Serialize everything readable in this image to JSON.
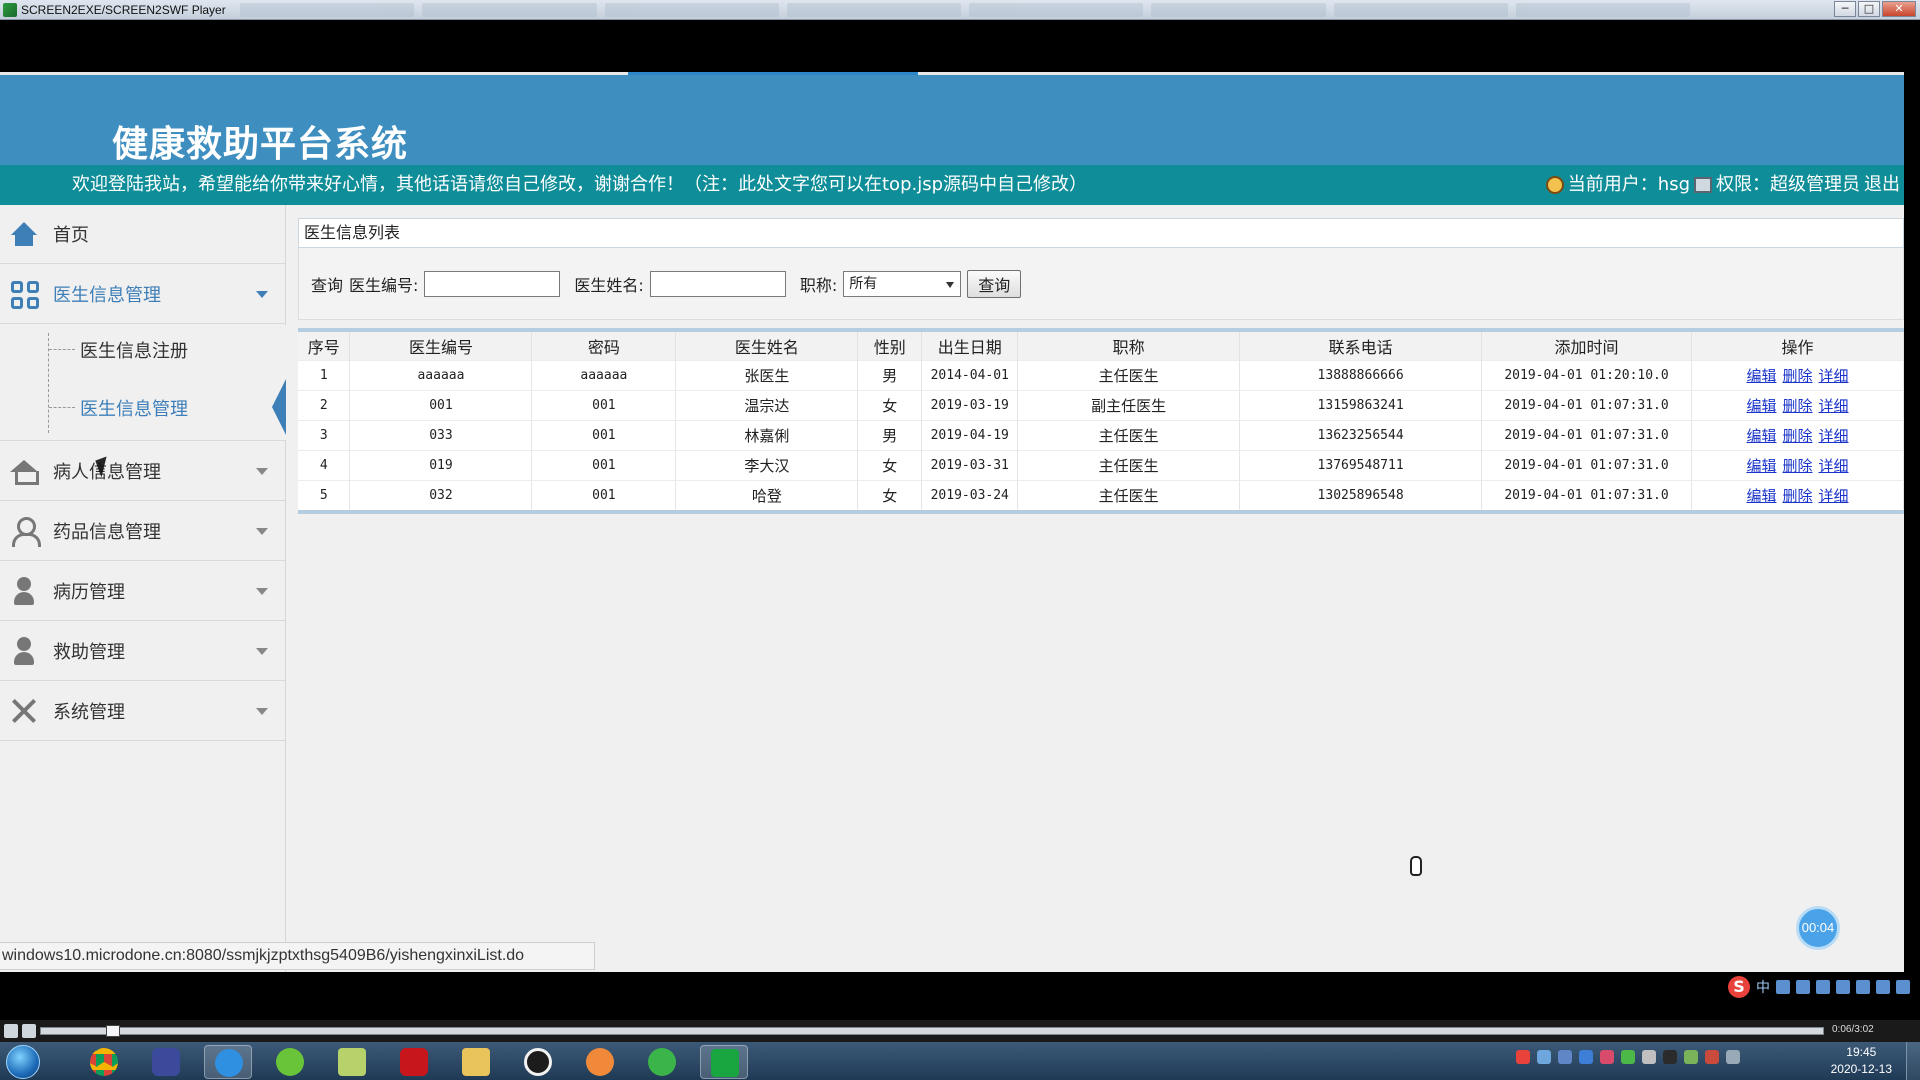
{
  "window": {
    "title": "SCREEN2EXE/SCREEN2SWF Player",
    "minimize": "─",
    "maximize": "□",
    "close": "✕"
  },
  "header": {
    "site_title": "健康救助平台系统",
    "welcome": "欢迎登陆我站，希望能给你带来好心情，其他话语请您自己修改，谢谢合作！（注：此处文字您可以在top.jsp源码中自己修改）",
    "current_user_label": "当前用户：hsg",
    "permission_label": "权限：超级管理员",
    "logout": "退出"
  },
  "sidebar": {
    "items": [
      {
        "label": "首页",
        "icon": "home-icon"
      },
      {
        "label": "医生信息管理",
        "icon": "grid-icon"
      },
      {
        "label": "病人信息管理",
        "icon": "house-icon"
      },
      {
        "label": "药品信息管理",
        "icon": "user-outline-icon"
      },
      {
        "label": "病历管理",
        "icon": "user-icon"
      },
      {
        "label": "救助管理",
        "icon": "user-icon"
      },
      {
        "label": "系统管理",
        "icon": "tools-icon"
      }
    ],
    "submenu": [
      {
        "label": "医生信息注册"
      },
      {
        "label": "医生信息管理"
      }
    ]
  },
  "main": {
    "panel_title": "医生信息列表",
    "search": {
      "query_label": "查询",
      "doctor_no_label": "医生编号:",
      "doctor_no_value": "",
      "doctor_name_label": "医生姓名:",
      "doctor_name_value": "",
      "title_label": "职称:",
      "title_selected": "所有",
      "button": "查询"
    },
    "table": {
      "headers": [
        "序号",
        "医生编号",
        "密码",
        "医生姓名",
        "性别",
        "出生日期",
        "职称",
        "联系电话",
        "添加时间",
        "操作"
      ],
      "ops": [
        "编辑",
        "删除",
        "详细"
      ],
      "rows": [
        {
          "seq": "1",
          "no": "aaaaaa",
          "pwd": "aaaaaa",
          "name": "张医生",
          "gender": "男",
          "birth": "2014-04-01",
          "title": "主任医生",
          "phone": "13888866666",
          "added": "2019-04-01 01:20:10.0"
        },
        {
          "seq": "2",
          "no": "001",
          "pwd": "001",
          "name": "温宗达",
          "gender": "女",
          "birth": "2019-03-19",
          "title": "副主任医生",
          "phone": "13159863241",
          "added": "2019-04-01 01:07:31.0"
        },
        {
          "seq": "3",
          "no": "033",
          "pwd": "001",
          "name": "林嘉俐",
          "gender": "男",
          "birth": "2019-04-19",
          "title": "主任医生",
          "phone": "13623256544",
          "added": "2019-04-01 01:07:31.0"
        },
        {
          "seq": "4",
          "no": "019",
          "pwd": "001",
          "name": "李大汉",
          "gender": "女",
          "birth": "2019-03-31",
          "title": "主任医生",
          "phone": "13769548711",
          "added": "2019-04-01 01:07:31.0"
        },
        {
          "seq": "5",
          "no": "032",
          "pwd": "001",
          "name": "哈登",
          "gender": "女",
          "birth": "2019-03-24",
          "title": "主任医生",
          "phone": "13025896548",
          "added": "2019-04-01 01:07:31.0"
        }
      ]
    }
  },
  "status_url": "windows10.microdone.cn:8080/ssmjkjzptxthsg5409B6/yishengxinxiList.do",
  "timer": "00:04",
  "player": {
    "time": "0:06/3:02"
  },
  "ime": {
    "lang": "中"
  },
  "taskbar": {
    "time": "19:45",
    "date": "2020-12-13"
  },
  "colors": {
    "header": "#3e8fbf",
    "notice_bar": "#0f8d98",
    "accent": "#3e7fb8",
    "link": "#1a33c9"
  }
}
